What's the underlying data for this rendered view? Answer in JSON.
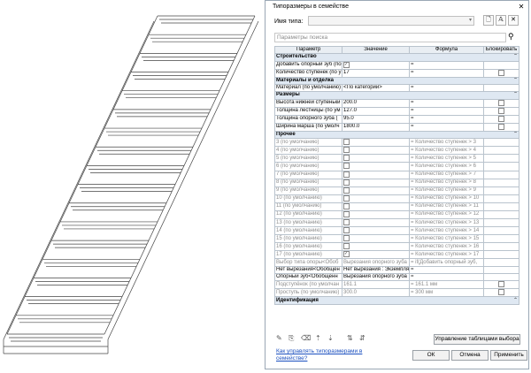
{
  "dialog": {
    "title": "Типоразмеры в семействе",
    "typename_label": "Имя типа:",
    "typename_value": "",
    "search_placeholder": "Параметры поиска",
    "columns": [
      "Параметр",
      "Значение",
      "Формула",
      "Блокировать"
    ],
    "groups": [
      {
        "name": "Строительство",
        "rows": [
          {
            "param": "Добавить опорный зуб (по",
            "value": "",
            "value_checkbox": true,
            "checked": true,
            "formula": "=",
            "lock": false,
            "gray": false
          },
          {
            "param": "Количество ступенек (по у",
            "value": "17",
            "value_checkbox": false,
            "formula": "=",
            "lock": true,
            "gray": false
          }
        ]
      },
      {
        "name": "Материалы и отделка",
        "rows": [
          {
            "param": "Материал (по умолчанию)",
            "value": "<По категории>",
            "value_checkbox": false,
            "formula": "=",
            "lock": false,
            "gray": false
          }
        ]
      },
      {
        "name": "Размеры",
        "rows": [
          {
            "param": "Высота нижней ступеньки",
            "value": "200.0",
            "value_checkbox": false,
            "formula": "=",
            "lock": true,
            "gray": false
          },
          {
            "param": "Толщина лестницы (по ум",
            "value": "127.0",
            "value_checkbox": false,
            "formula": "=",
            "lock": true,
            "gray": false
          },
          {
            "param": "Толщина опорного зуба (",
            "value": "95.0",
            "value_checkbox": false,
            "formula": "=",
            "lock": true,
            "gray": false
          },
          {
            "param": "Ширина марша (по умолч",
            "value": "1800.0",
            "value_checkbox": false,
            "formula": "=",
            "lock": true,
            "gray": false
          }
        ]
      },
      {
        "name": "Прочее",
        "rows": [
          {
            "param": "3 (по умолчанию)",
            "value": "",
            "value_checkbox": true,
            "checked": false,
            "formula": "= Количество ступенек > 3",
            "lock": false,
            "gray": true
          },
          {
            "param": "4 (по умолчанию)",
            "value": "",
            "value_checkbox": true,
            "checked": false,
            "formula": "= Количество ступенек > 4",
            "lock": false,
            "gray": true
          },
          {
            "param": "5 (по умолчанию)",
            "value": "",
            "value_checkbox": true,
            "checked": false,
            "formula": "= Количество ступенек > 5",
            "lock": false,
            "gray": true
          },
          {
            "param": "6 (по умолчанию)",
            "value": "",
            "value_checkbox": true,
            "checked": false,
            "formula": "= Количество ступенек > 6",
            "lock": false,
            "gray": true
          },
          {
            "param": "7 (по умолчанию)",
            "value": "",
            "value_checkbox": true,
            "checked": false,
            "formula": "= Количество ступенек > 7",
            "lock": false,
            "gray": true
          },
          {
            "param": "8 (по умолчанию)",
            "value": "",
            "value_checkbox": true,
            "checked": false,
            "formula": "= Количество ступенек > 8",
            "lock": false,
            "gray": true
          },
          {
            "param": "9 (по умолчанию)",
            "value": "",
            "value_checkbox": true,
            "checked": false,
            "formula": "= Количество ступенек > 9",
            "lock": false,
            "gray": true
          },
          {
            "param": "10 (по умолчанию)",
            "value": "",
            "value_checkbox": true,
            "checked": false,
            "formula": "= Количество ступенек > 10",
            "lock": false,
            "gray": true
          },
          {
            "param": "11 (по умолчанию)",
            "value": "",
            "value_checkbox": true,
            "checked": false,
            "formula": "= Количество ступенек > 11",
            "lock": false,
            "gray": true
          },
          {
            "param": "12 (по умолчанию)",
            "value": "",
            "value_checkbox": true,
            "checked": false,
            "formula": "= Количество ступенек > 12",
            "lock": false,
            "gray": true
          },
          {
            "param": "13 (по умолчанию)",
            "value": "",
            "value_checkbox": true,
            "checked": false,
            "formula": "= Количество ступенек > 13",
            "lock": false,
            "gray": true
          },
          {
            "param": "14 (по умолчанию)",
            "value": "",
            "value_checkbox": true,
            "checked": false,
            "formula": "= Количество ступенек > 14",
            "lock": false,
            "gray": true
          },
          {
            "param": "15 (по умолчанию)",
            "value": "",
            "value_checkbox": true,
            "checked": false,
            "formula": "= Количество ступенек > 15",
            "lock": false,
            "gray": true
          },
          {
            "param": "16 (по умолчанию)",
            "value": "",
            "value_checkbox": true,
            "checked": false,
            "formula": "= Количество ступенек > 16",
            "lock": false,
            "gray": true
          },
          {
            "param": "17 (по умолчанию)",
            "value": "",
            "value_checkbox": true,
            "checked": true,
            "formula": "= Количество ступенек > 17",
            "lock": false,
            "gray": true
          },
          {
            "param": "Выбор типа опоры<Обоб",
            "value": "Вырезания опорного зуба :",
            "value_checkbox": false,
            "formula": "= if(Добавить опорный зуб,",
            "lock": false,
            "gray": true
          },
          {
            "param": "Нет вырезания<Обобщен",
            "value": "Нет вырезания : Экземпляр",
            "value_checkbox": false,
            "formula": "=",
            "lock": false,
            "gray": false
          },
          {
            "param": "Опорный зуб<Обобщенн",
            "value": "Вырезания опорного зуба :",
            "value_checkbox": false,
            "formula": "=",
            "lock": false,
            "gray": false
          },
          {
            "param": "Подступёнок (по умолчан",
            "value": "161.1",
            "value_checkbox": false,
            "formula": "= 161.1 мм",
            "lock": true,
            "gray": true
          },
          {
            "param": "Проступь (по умолчанию)",
            "value": "300.0",
            "value_checkbox": false,
            "formula": "= 300 мм",
            "lock": true,
            "gray": true
          }
        ]
      },
      {
        "name": "Идентификация",
        "rows": []
      }
    ],
    "manage_button": "Управление таблицами выбора",
    "help_link": "Как управлять типоразмерами в семействе?",
    "ok_button": "ОК",
    "cancel_button": "Отмена",
    "apply_button": "Применить",
    "close_glyph": "✕",
    "chevron_glyph": "⌃"
  },
  "stairs": {
    "steps": 17
  }
}
